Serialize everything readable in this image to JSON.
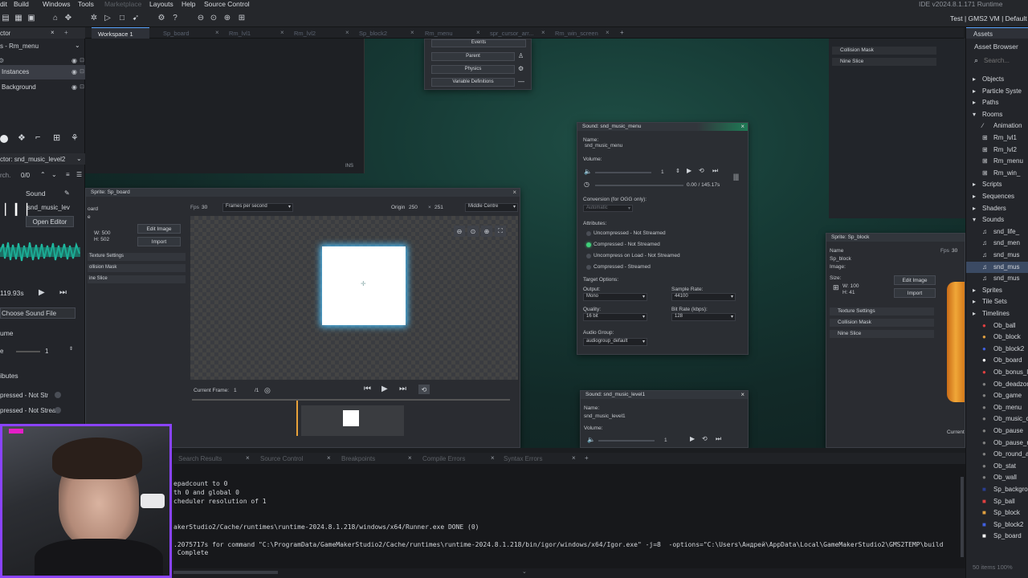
{
  "menu": {
    "items": [
      "dit",
      "Build",
      "Windows",
      "Tools",
      "Marketplace",
      "Layouts",
      "Help",
      "Source Control"
    ],
    "ide_version": "IDE v2024.8.1.171  Runtime v2024.8",
    "target": "Test | GMS2 VM | Default"
  },
  "tabs": [
    {
      "label": "Workspace 1",
      "active": true
    },
    {
      "label": "Sp_board"
    },
    {
      "label": "Rm_lvl1"
    },
    {
      "label": "Rm_lvl2"
    },
    {
      "label": "Sp_block2"
    },
    {
      "label": "Rm_menu"
    },
    {
      "label": "spr_cursor_arr..."
    },
    {
      "label": "Rm_win_screen"
    }
  ],
  "left": {
    "header": "ctor",
    "room": "s - Rm_menu",
    "layers": [
      "Instances",
      "Background"
    ],
    "inspector_title": "ctor: snd_music_level2",
    "search_count": "0/0",
    "search_label": "rch.",
    "sound_header": "Sound",
    "sound_name": "snd_music_lev",
    "open_editor": "Open Editor",
    "duration": "119.93s",
    "choose_file": "Choose Sound File",
    "volume_label": "ume",
    "volume_short": "e",
    "volume_value": "1",
    "attributes": "ibutes",
    "attr1": "pressed - Not Str",
    "attr2": "pressed - Not Streai"
  },
  "objpanel": {
    "events": "Events",
    "parent": "Parent",
    "physics": "Physics",
    "vardefs": "Variable Definitions",
    "ins": "INS"
  },
  "sprite_editor": {
    "title": "Sprite: Sp_board",
    "name_label": "e",
    "name_value": "oard",
    "img_label": "e",
    "w": "W: 500",
    "h": "H: 502",
    "edit_image": "Edit Image",
    "import": "Import",
    "texture_settings": "Texture Settings",
    "collision_mask": "ollision Mask",
    "nine_slice": "ine Slice",
    "fps_label": "Fps",
    "fps_value": "30",
    "fps_mode": "Frames per second",
    "origin_label": "Origin",
    "origin_x": "250",
    "origin_y": "251",
    "origin_mode": "Middle Centre",
    "current_frame_label": "Current Frame:",
    "current_frame": "1",
    "frame_total": "/1"
  },
  "sound_menu": {
    "title": "Sound: snd_music_menu",
    "name_label": "Name:",
    "name_value": "snd_music_menu",
    "volume_label": "Volume:",
    "volume_value": "1",
    "time": "0.00 / 145.17s",
    "conversion_label": "Conversion (for OGG only):",
    "conversion_value": "Automatic",
    "attributes_label": "Attributes:",
    "attrs": [
      "Uncompressed - Not Streamed",
      "Compressed - Not Streamed",
      "Uncompress on Load - Not Streamed",
      "Compressed - Streamed"
    ],
    "selected_attr": 1,
    "target_label": "Target Options:",
    "output_label": "Output:",
    "output_value": "Mono",
    "sample_rate_label": "Sample Rate:",
    "sample_rate_value": "44100",
    "quality_label": "Quality:",
    "quality_value": "16 bit",
    "bitrate_label": "Bit Rate (kbps):",
    "bitrate_value": "128",
    "audio_group_label": "Audio Group:",
    "audio_group_value": "audiogroup_default"
  },
  "sound_level1": {
    "title": "Sound: snd_music_level1",
    "name_label": "Name:",
    "name_value": "snd_music_level1",
    "volume_label": "Volume:",
    "volume_value": "1"
  },
  "collision_panel": {
    "texture": "Texture Settings",
    "collision": "Collision Mask",
    "nine": "Nine Slice"
  },
  "sprite_block": {
    "title": "Sprite: Sp_block",
    "name_label": "Name",
    "name_value": "Sp_block",
    "image_label": "Image:",
    "size_label": "Size:",
    "w": "W: 100",
    "h": "H: 41",
    "edit_image": "Edit Image",
    "import": "Import",
    "texture": "Texture Settings",
    "collision": "Collision Mask",
    "nine": "Nine Slice",
    "fps_label": "Fps",
    "fps_value": "30",
    "current": "Current"
  },
  "assets": {
    "tab": "Assets",
    "browser": "Asset Browser",
    "search": "Search...",
    "items": [
      {
        "label": "Objects",
        "kind": "folder"
      },
      {
        "label": "Particle Syste",
        "kind": "folder"
      },
      {
        "label": "Paths",
        "kind": "folder"
      },
      {
        "label": "Rooms",
        "kind": "folder-open"
      },
      {
        "label": "Animation",
        "kind": "item"
      },
      {
        "label": "Rm_lvl1",
        "kind": "room"
      },
      {
        "label": "Rm_lvl2",
        "kind": "room"
      },
      {
        "label": "Rm_menu",
        "kind": "room"
      },
      {
        "label": "Rm_win_",
        "kind": "room"
      },
      {
        "label": "Scripts",
        "kind": "folder"
      },
      {
        "label": "Sequences",
        "kind": "folder"
      },
      {
        "label": "Shaders",
        "kind": "folder"
      },
      {
        "label": "Sounds",
        "kind": "folder-open"
      },
      {
        "label": "snd_life_",
        "kind": "sound"
      },
      {
        "label": "snd_men",
        "kind": "sound"
      },
      {
        "label": "snd_mus",
        "kind": "sound"
      },
      {
        "label": "snd_mus",
        "kind": "sound",
        "selected": true
      },
      {
        "label": "snd_mus",
        "kind": "sound"
      },
      {
        "label": "Sprites",
        "kind": "folder"
      },
      {
        "label": "Tile Sets",
        "kind": "folder"
      },
      {
        "label": "Timelines",
        "kind": "folder"
      },
      {
        "label": "Ob_ball",
        "kind": "obj",
        "color": "#e04040"
      },
      {
        "label": "Ob_block",
        "kind": "obj",
        "color": "#e0a040"
      },
      {
        "label": "Ob_block2",
        "kind": "obj",
        "color": "#4060e0"
      },
      {
        "label": "Ob_board",
        "kind": "obj",
        "color": "#ffffff"
      },
      {
        "label": "Ob_bonus_l",
        "kind": "obj",
        "color": "#e04040"
      },
      {
        "label": "Ob_deadzon",
        "kind": "obj",
        "color": "#808080"
      },
      {
        "label": "Ob_game",
        "kind": "obj",
        "color": "#808080"
      },
      {
        "label": "Ob_menu",
        "kind": "obj",
        "color": "#808080"
      },
      {
        "label": "Ob_music_c",
        "kind": "obj",
        "color": "#808080"
      },
      {
        "label": "Ob_pause",
        "kind": "obj",
        "color": "#808080"
      },
      {
        "label": "Ob_pause_r",
        "kind": "obj",
        "color": "#808080"
      },
      {
        "label": "Ob_round_a",
        "kind": "obj",
        "color": "#808080"
      },
      {
        "label": "Ob_stat",
        "kind": "obj",
        "color": "#808080"
      },
      {
        "label": "Ob_wall",
        "kind": "obj",
        "color": "#808080"
      },
      {
        "label": "Sp_backgro",
        "kind": "spr",
        "color": "#2a3d8f"
      },
      {
        "label": "Sp_ball",
        "kind": "spr",
        "color": "#e04040"
      },
      {
        "label": "Sp_block",
        "kind": "spr",
        "color": "#e0a040"
      },
      {
        "label": "Sp_block2",
        "kind": "spr",
        "color": "#4060e0"
      },
      {
        "label": "Sp_board",
        "kind": "spr",
        "color": "#ffffff"
      }
    ],
    "zoom": "50 items  100%"
  },
  "output_tabs": [
    "Search Results",
    "Source Control",
    "Breakpoints",
    "Compile Errors",
    "Syntax Errors"
  ],
  "output_lines": [
    "epadcount to 0",
    "th 0 and global 0",
    "cheduler resolution of 1",
    "",
    "",
    "akerStudio2/Cache/runtimes\\runtime-2024.8.1.218/windows/x64/Runner.exe DONE (0)",
    "",
    ".2075717s for command \"C:\\ProgramData/GameMakerStudio2/Cache/runtimes\\runtime-2024.8.1.218/bin/igor/windows/x64/Igor.exe\" -j=8  -options=\"C:\\Users\\Андрей\\AppData\\Local\\GameMakerStudio2\\GMS2TEMP\\build",
    " Complete"
  ]
}
